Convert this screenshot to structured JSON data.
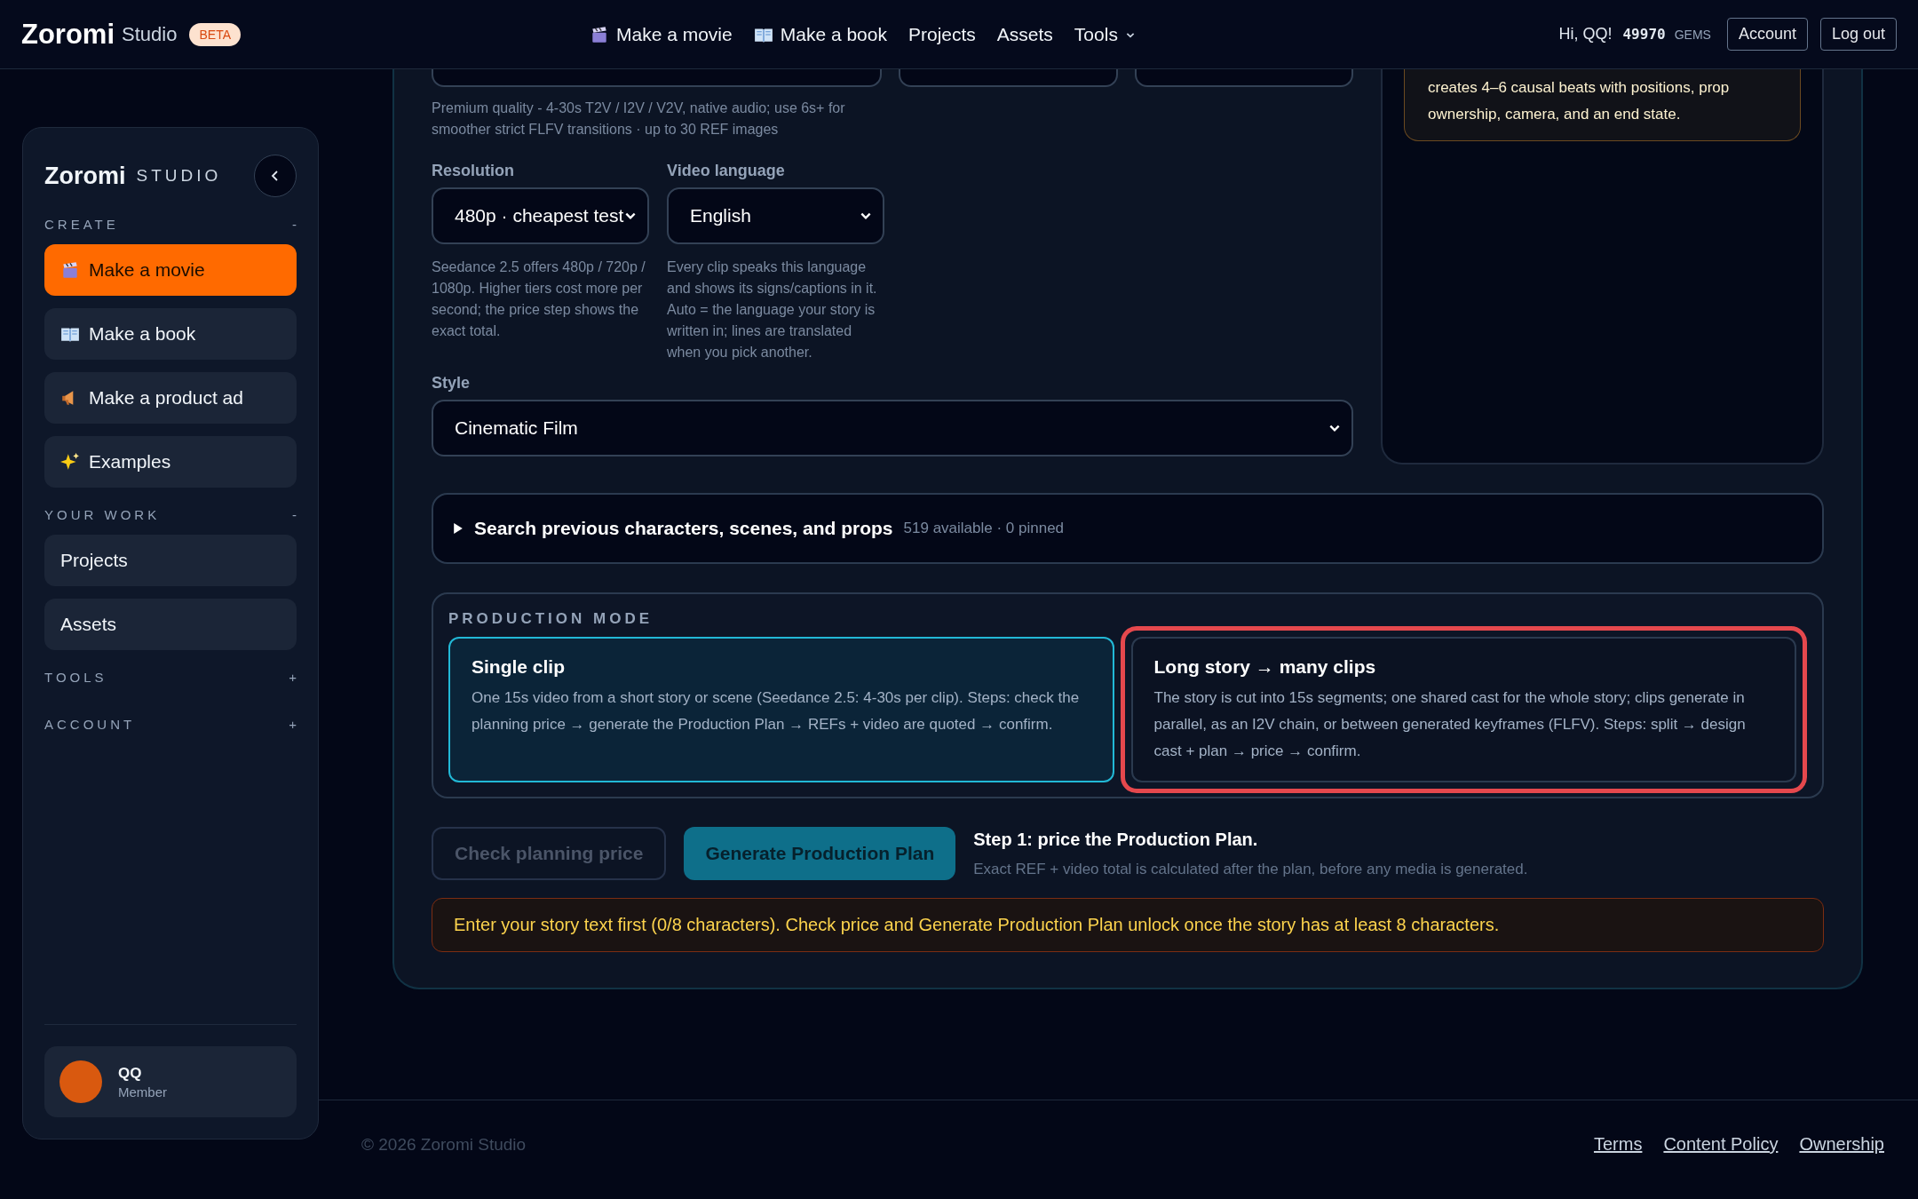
{
  "topbar": {
    "logo": "Zoromi",
    "logo_suffix": "Studio",
    "badge": "BETA",
    "nav": [
      {
        "label": "Make a movie",
        "kind": "link"
      },
      {
        "label": "Make a book",
        "kind": "link"
      },
      {
        "label": "Projects",
        "kind": "link"
      },
      {
        "label": "Assets",
        "kind": "link"
      },
      {
        "label": "Tools",
        "kind": "menu"
      }
    ],
    "greeting": "Hi, QQ!",
    "gems": "49970",
    "gems_unit": "GEMS",
    "buttons": [
      "Account",
      "Log out"
    ]
  },
  "sidebar": {
    "logo": "Zoromi",
    "logo_suffix": "STUDIO",
    "sections": [
      {
        "title": "CREATE",
        "toggle": "-",
        "items": [
          {
            "label": "Make a movie",
            "selected": true
          },
          {
            "label": "Make a book",
            "selected": false
          },
          {
            "label": "Make a product ad",
            "selected": false
          },
          {
            "label": "Examples",
            "selected": false
          }
        ]
      },
      {
        "title": "YOUR WORK",
        "toggle": "-",
        "items": [
          {
            "label": "Projects",
            "selected": false
          },
          {
            "label": "Assets",
            "selected": false
          }
        ]
      },
      {
        "title": "TOOLS",
        "toggle": "+"
      },
      {
        "title": "ACCOUNT",
        "toggle": "+"
      }
    ],
    "profile": {
      "name": "QQ",
      "role": "Member"
    }
  },
  "form": {
    "model_hint": "Premium quality - 4-30s T2V / I2V / V2V, native audio; use 6s+ for smoother strict FLFV transitions · up to 30 REF images",
    "resolution": {
      "label": "Resolution",
      "value": "480p · cheapest test",
      "hint": "Seedance 2.5 offers 480p / 720p / 1080p. Higher tiers cost more per second; the price step shows the exact total."
    },
    "video_language": {
      "label": "Video language",
      "value": "English",
      "hint": "Every clip speaks this language and shows its signs/captions in it. Auto = the language your story is written in; lines are translated when you pick another."
    },
    "style": {
      "label": "Style",
      "value": "Cinematic Film"
    },
    "note": "creates 4–6 causal beats with positions, prop ownership, camera, and an end state."
  },
  "library": {
    "expanded": false,
    "title": "Search previous characters, scenes, and props",
    "meta": "519 available · 0 pinned"
  },
  "production_mode": {
    "label": "PRODUCTION MODE",
    "options": [
      {
        "title": "Single clip",
        "description": "One 15s video from a short story or scene (Seedance 2.5: 4-30s per clip). Steps: check the planning price → generate the Production Plan → REFs + video are quoted → confirm.",
        "selected": true,
        "highlighted": false
      },
      {
        "title": "Long story → many clips",
        "description": "The story is cut into 15s segments; one shared cast for the whole story; clips generate in parallel, as an I2V chain, or between generated keyframes (FLFV). Steps: split → design cast + plan → price → confirm.",
        "selected": false,
        "highlighted": true
      }
    ]
  },
  "actions": {
    "buttons": [
      {
        "label": "Check planning price",
        "kind": "secondary",
        "disabled": true
      },
      {
        "label": "Generate Production Plan",
        "kind": "primary",
        "disabled": false
      }
    ],
    "step_title": "Step 1: price the Production Plan.",
    "step_note": "Exact REF + video total is calculated after the plan, before any media is generated."
  },
  "warning": "Enter your story text first (0/8 characters). Check price and Generate Production Plan unlock once the story has at least 8 characters.",
  "footer": {
    "copyright": "© 2026 Zoromi Studio",
    "links": [
      "Terms",
      "Content Policy",
      "Ownership"
    ]
  }
}
